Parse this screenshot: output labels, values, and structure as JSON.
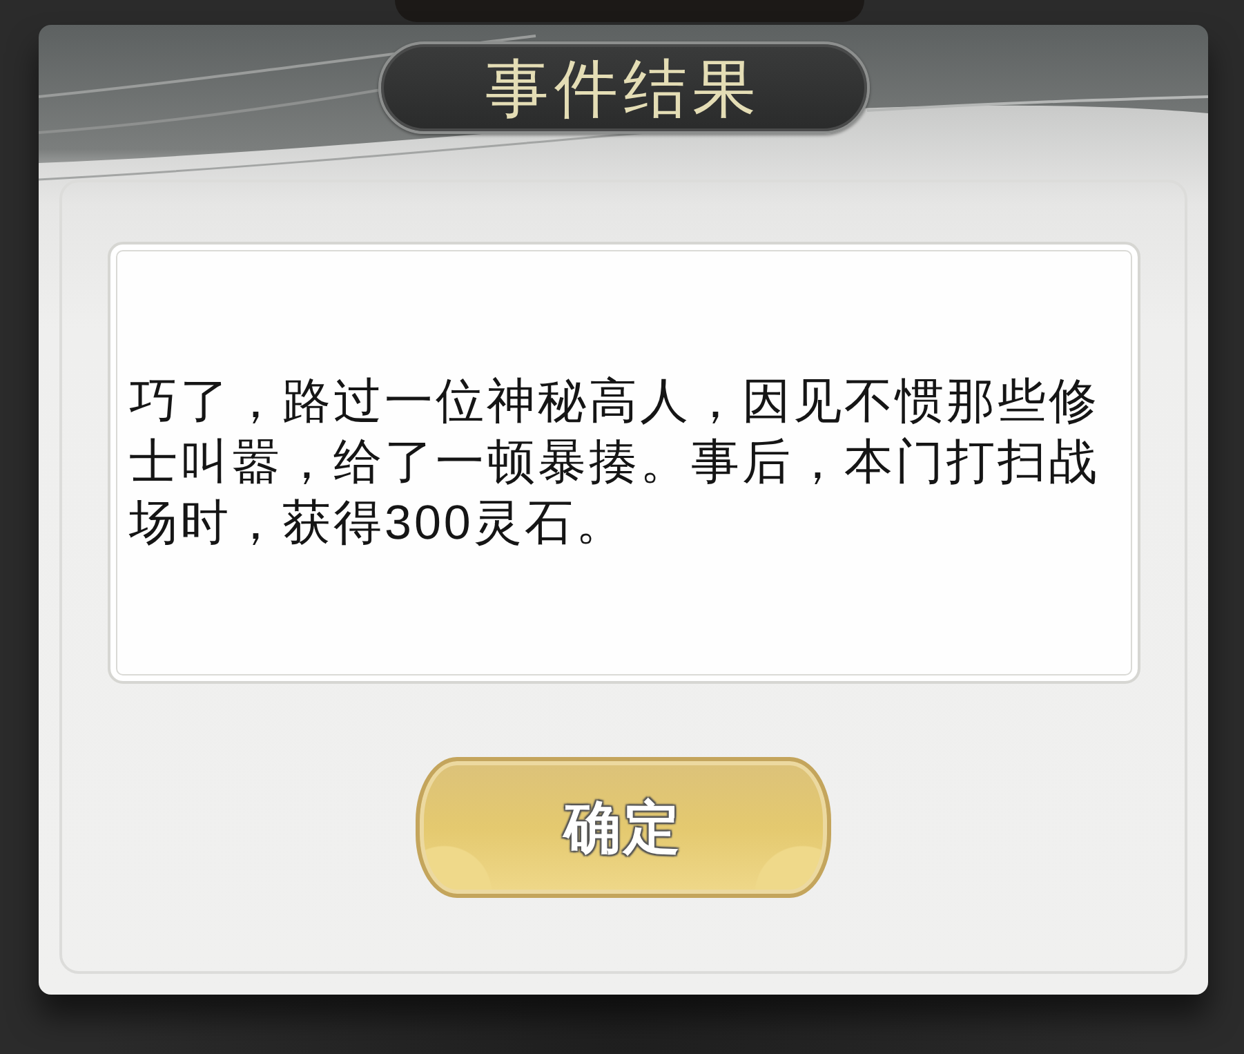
{
  "dialog": {
    "title": "事件结果",
    "message": "巧了，路过一位神秘高人，因见不惯那些修士叫嚣，给了一顿暴揍。事后，本门打扫战场时，获得300灵石。",
    "confirm_button": "确定"
  }
}
